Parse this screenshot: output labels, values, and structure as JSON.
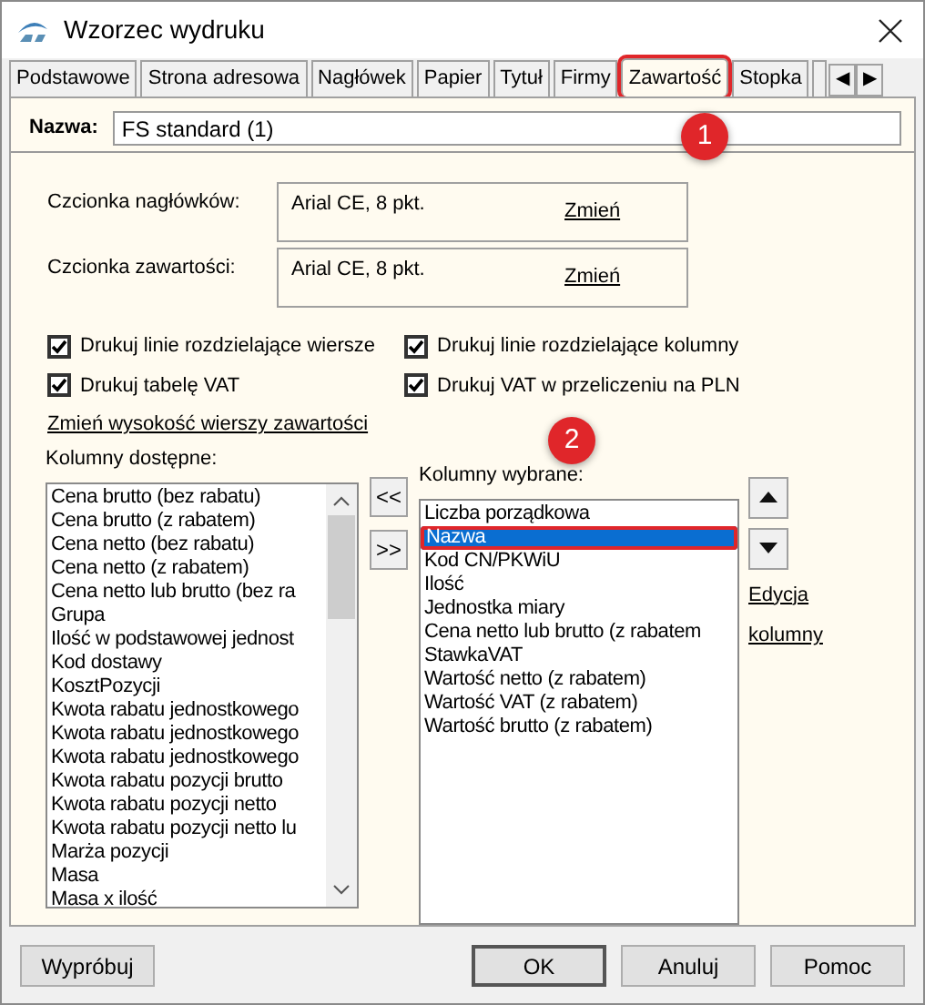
{
  "window": {
    "title": "Wzorzec wydruku"
  },
  "tabs": [
    {
      "label": "Podstawowe",
      "selected": false
    },
    {
      "label": "Strona adresowa",
      "selected": false
    },
    {
      "label": "Nagłówek",
      "selected": false
    },
    {
      "label": "Papier",
      "selected": false
    },
    {
      "label": "Tytuł",
      "selected": false
    },
    {
      "label": "Firmy",
      "selected": false
    },
    {
      "label": "Zawartość",
      "selected": true
    },
    {
      "label": "Stopka",
      "selected": false
    }
  ],
  "tab_scroll": [
    "◀",
    "▶"
  ],
  "annotations": [
    "1",
    "2"
  ],
  "name_field": {
    "label": "Nazwa:",
    "value": "FS standard (1)"
  },
  "fonts": [
    {
      "label": "Czcionka nagłówków:",
      "value": "Arial CE, 8 pkt.",
      "link": "Zmień"
    },
    {
      "label": "Czcionka zawartości:",
      "value": "Arial CE, 8 pkt.",
      "link": "Zmień"
    }
  ],
  "checkboxes": [
    {
      "label": "Drukuj linie rozdzielające wiersze",
      "checked": true
    },
    {
      "label": "Drukuj linie rozdzielające kolumny",
      "checked": true
    },
    {
      "label": "Drukuj tabelę VAT",
      "checked": true
    },
    {
      "label": "Drukuj VAT w przeliczeniu na PLN",
      "checked": true
    }
  ],
  "row_height_link": "Zmień wysokość wierszy zawartości",
  "available_columns": {
    "label": "Kolumny dostępne:",
    "items": [
      "Cena brutto (bez rabatu)",
      "Cena brutto (z rabatem)",
      "Cena netto (bez rabatu)",
      "Cena netto (z rabatem)",
      "Cena netto lub brutto (bez ra",
      "Grupa",
      "Ilość w podstawowej jednost",
      "Kod dostawy",
      "KosztPozycji",
      "Kwota rabatu jednostkowego",
      "Kwota rabatu jednostkowego",
      "Kwota rabatu jednostkowego",
      "Kwota rabatu pozycji brutto",
      "Kwota rabatu pozycji netto",
      "Kwota rabatu pozycji netto lu",
      "Marża pozycji",
      "Masa",
      "Masa x ilość"
    ]
  },
  "move_buttons": [
    "<<",
    ">>"
  ],
  "selected_columns": {
    "label": "Kolumny wybrane:",
    "items": [
      {
        "label": "Liczba porządkowa",
        "selected": false
      },
      {
        "label": "Nazwa",
        "selected": true
      },
      {
        "label": "Kod CN/PKWiU",
        "selected": false
      },
      {
        "label": "Ilość",
        "selected": false
      },
      {
        "label": "Jednostka miary",
        "selected": false
      },
      {
        "label": "Cena netto lub brutto (z rabatem",
        "selected": false
      },
      {
        "label": "StawkaVAT",
        "selected": false
      },
      {
        "label": "Wartość netto (z rabatem)",
        "selected": false
      },
      {
        "label": "Wartość VAT (z rabatem)",
        "selected": false
      },
      {
        "label": "Wartość brutto (z rabatem)",
        "selected": false
      }
    ]
  },
  "edit_link": [
    "Edycja",
    "kolumny"
  ],
  "footer_buttons": [
    {
      "label": "Wypróbuj",
      "default": false
    },
    {
      "label": "OK",
      "default": true
    },
    {
      "label": "Anuluj",
      "default": false
    },
    {
      "label": "Pomoc",
      "default": false
    }
  ]
}
